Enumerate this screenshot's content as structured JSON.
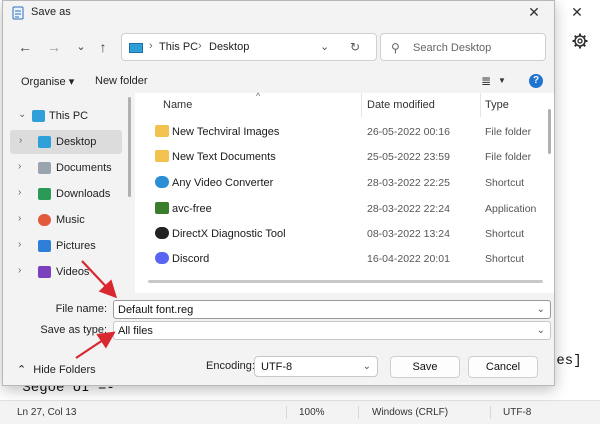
{
  "background_app": {
    "close_glyph": "✕",
    "gear_icon": "gear-icon",
    "text_fragment_right": "tes]",
    "text_fragment_left": "\"Segoe UI\"=-",
    "status": {
      "position": "Ln 27, Col 13",
      "zoom": "100%",
      "line_endings": "Windows (CRLF)",
      "encoding": "UTF-8"
    }
  },
  "dialog": {
    "title": "Save as",
    "close_glyph": "✕",
    "nav": {
      "back": "←",
      "forward": "→",
      "recent": "⌄",
      "up": "↑"
    },
    "address": {
      "crumbs": [
        "This PC",
        "Desktop"
      ],
      "separator": "›",
      "dropdown": "⌄",
      "refresh": "↻"
    },
    "search": {
      "placeholder": "Search Desktop",
      "icon": "⚲"
    },
    "commands": {
      "organise": "Organise ▾",
      "new_folder": "New folder",
      "view_icon": "≣",
      "view_dropdown": "▼",
      "help": "?"
    },
    "nav_pane": {
      "items": [
        {
          "label": "This PC",
          "chevron": "⌄",
          "icon": "monitor-icon",
          "color": "#2e9fd8"
        },
        {
          "label": "Desktop",
          "chevron": "›",
          "icon": "desktop-icon",
          "color": "#2e9fd8"
        },
        {
          "label": "Documents",
          "chevron": "›",
          "icon": "documents-icon",
          "color": "#9aa4ae"
        },
        {
          "label": "Downloads",
          "chevron": "›",
          "icon": "downloads-icon",
          "color": "#2b9a57"
        },
        {
          "label": "Music",
          "chevron": "›",
          "icon": "music-icon",
          "color": "#e05a3b"
        },
        {
          "label": "Pictures",
          "chevron": "›",
          "icon": "pictures-icon",
          "color": "#2f7ed8"
        },
        {
          "label": "Videos",
          "chevron": "›",
          "icon": "videos-icon",
          "color": "#7b3fbe"
        }
      ]
    },
    "columns": {
      "name": "Name",
      "date": "Date modified",
      "type": "Type",
      "sort_glyph": "^"
    },
    "files": [
      {
        "name": "New Techviral Images",
        "date": "26-05-2022 00:16",
        "type": "File folder",
        "icon": "folder-icon",
        "color": "#f2c14e"
      },
      {
        "name": "New Text Documents",
        "date": "25-05-2022 23:59",
        "type": "File folder",
        "icon": "folder-icon",
        "color": "#f2c14e"
      },
      {
        "name": "Any Video Converter",
        "date": "28-03-2022 22:25",
        "type": "Shortcut",
        "icon": "video-converter-icon",
        "color": "#2b8fd6"
      },
      {
        "name": "avc-free",
        "date": "28-03-2022 22:24",
        "type": "Application",
        "icon": "avc-app-icon",
        "color": "#3a7d2c"
      },
      {
        "name": "DirectX Diagnostic Tool",
        "date": "08-03-2022 13:24",
        "type": "Shortcut",
        "icon": "directx-icon",
        "color": "#222222"
      },
      {
        "name": "Discord",
        "date": "16-04-2022 20:01",
        "type": "Shortcut",
        "icon": "discord-icon",
        "color": "#5865f2"
      }
    ],
    "file_name": {
      "label": "File name:",
      "value": "Default font.reg",
      "dropdown": "⌄"
    },
    "save_as_type": {
      "label": "Save as type:",
      "value": "All files",
      "dropdown": "⌄"
    },
    "footer": {
      "hide_folders": "Hide Folders",
      "hide_glyph": "⌃",
      "encoding_label": "Encoding:",
      "encoding_value": "UTF-8",
      "encoding_dropdown": "⌄",
      "save": "Save",
      "cancel": "Cancel"
    }
  },
  "colors": {
    "annotation": "#d9282f",
    "accent": "#1f73d1"
  }
}
